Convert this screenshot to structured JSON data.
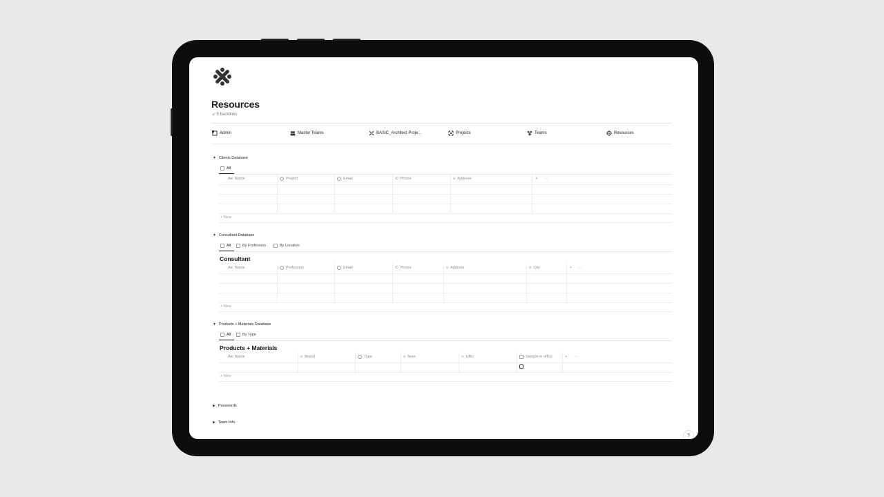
{
  "page": {
    "title": "Resources",
    "backlinks": "↙ 5 backlinks"
  },
  "nav": [
    {
      "label": "Admin",
      "icon": "admin-icon"
    },
    {
      "label": "Master Teams",
      "icon": "people-icon"
    },
    {
      "label": "BASIC_Architect Proje...",
      "icon": "arrows-icon"
    },
    {
      "label": "Projects",
      "icon": "projects-icon"
    },
    {
      "label": "Teams",
      "icon": "teams-icon"
    },
    {
      "label": "Resources",
      "icon": "resources-icon"
    }
  ],
  "clients": {
    "section": "Clients Database",
    "tabs": [
      "All"
    ],
    "columns": [
      "Name",
      "Project",
      "Email",
      "Phone",
      "Address"
    ],
    "new_label": "+ New",
    "add": "+",
    "more": "···"
  },
  "consultant": {
    "section": "Consultant Database",
    "tabs": [
      "All",
      "By Profession",
      "By Location"
    ],
    "db_title": "Consultant",
    "columns": [
      "Name",
      "Profession",
      "Email",
      "Phone",
      "Address",
      "City"
    ],
    "new_label": "+ New",
    "add": "+",
    "more": "···"
  },
  "products": {
    "section": "Products + Materials Database",
    "tabs": [
      "All",
      "By Type"
    ],
    "db_title": "Products + Materials",
    "columns": [
      "Name",
      "Brand",
      "Type",
      "Note",
      "URL",
      "Sample in office"
    ],
    "new_label": "+ New",
    "add": "+",
    "more": "···"
  },
  "collapsed": [
    "Passwords",
    "Team Info"
  ],
  "help": "?"
}
